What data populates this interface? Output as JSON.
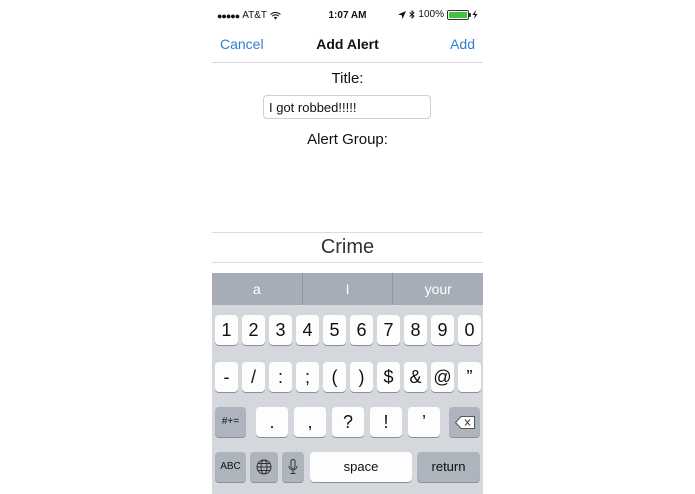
{
  "status_bar": {
    "signal": "●●●●●",
    "carrier": "AT&T",
    "wifi": "wifi-icon",
    "time": "1:07 AM",
    "battery_percent": "100%"
  },
  "nav": {
    "cancel": "Cancel",
    "title": "Add Alert",
    "add": "Add"
  },
  "form": {
    "title_label": "Title:",
    "title_value": "I got robbed!!!!!",
    "group_label": "Alert Group:",
    "group_selected": "Crime"
  },
  "keyboard": {
    "suggestions": [
      "a",
      "I",
      "your"
    ],
    "row1": [
      "1",
      "2",
      "3",
      "4",
      "5",
      "6",
      "7",
      "8",
      "9",
      "0"
    ],
    "row2": [
      "-",
      "/",
      ":",
      ";",
      "(",
      ")",
      "$",
      "&",
      "@",
      "”"
    ],
    "row3_toggle": "#+=",
    "row3": [
      ".",
      ",",
      "?",
      "!",
      "’"
    ],
    "abc": "ABC",
    "space": "space",
    "return": "return"
  },
  "colors": {
    "accent": "#2f7fd1",
    "battery": "#3fc43a",
    "keyboard_bg": "#d4d7dc",
    "suggestion_bg": "#a6adb6"
  }
}
